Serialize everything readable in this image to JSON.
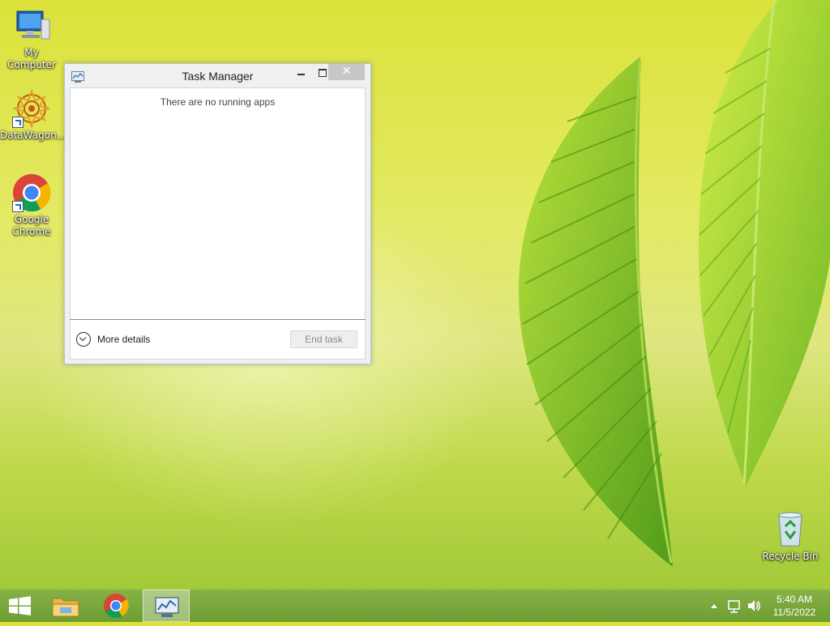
{
  "desktop": {
    "icons": [
      {
        "label": "My Computer"
      },
      {
        "label": "DataWagon..."
      },
      {
        "label": "Google Chrome"
      },
      {
        "label": "Recycle Bin"
      }
    ]
  },
  "task_manager": {
    "title": "Task Manager",
    "empty_message": "There are no running apps",
    "more_details_label": "More details",
    "end_task_label": "End task",
    "close_glyph": "✕"
  },
  "taskbar": {
    "items": [
      "start-button",
      "file-explorer",
      "google-chrome",
      "task-manager"
    ],
    "active_item": "task-manager",
    "tray": {
      "time": "5:40 AM",
      "date": "11/5/2022"
    }
  },
  "colors": {
    "taskbar": "#79a83c",
    "wallpaper_yellow": "#dfe64e",
    "leaf_green": "#7cc22a"
  }
}
